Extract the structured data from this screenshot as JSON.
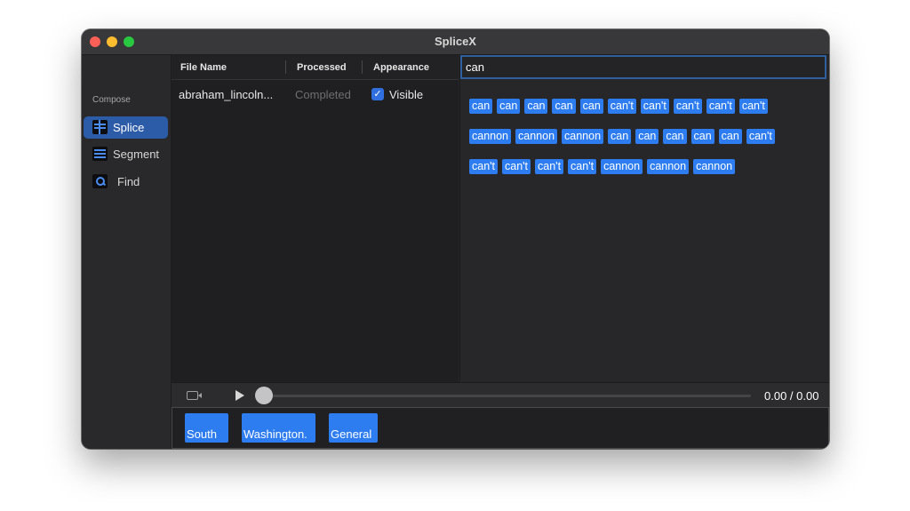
{
  "window": {
    "title": "SpliceX"
  },
  "sidebar": {
    "section": "Compose",
    "items": [
      {
        "label": "Splice",
        "icon": "splice-grid-icon",
        "active": true
      },
      {
        "label": "Segment",
        "icon": "segment-list-icon",
        "active": false
      },
      {
        "label": "Find",
        "icon": "magnifier-icon",
        "active": false
      }
    ]
  },
  "file_table": {
    "columns": [
      "File Name",
      "Processed",
      "Appearance"
    ],
    "rows": [
      {
        "file_name": "abraham_lincoln...",
        "processed": "Completed",
        "visible_checked": true,
        "appearance": "Visible"
      }
    ]
  },
  "search": {
    "value": "can",
    "results": [
      [
        "can",
        "can",
        "can",
        "can",
        "can",
        "can't",
        "can't",
        "can't",
        "can't",
        "can't"
      ],
      [
        "cannon",
        "cannon",
        "cannon",
        "can",
        "can",
        "can",
        "can",
        "can",
        "can't"
      ],
      [
        "can't",
        "can't",
        "can't",
        "can't",
        "cannon",
        "cannon",
        "cannon"
      ]
    ]
  },
  "player": {
    "time": "0.00 / 0.00",
    "progress": 0
  },
  "clips": [
    "South",
    "Washington.",
    "General"
  ],
  "colors": {
    "accent": "#2d7cf0",
    "sidebar_active": "#2c5ca8",
    "window_bg": "#262528"
  }
}
